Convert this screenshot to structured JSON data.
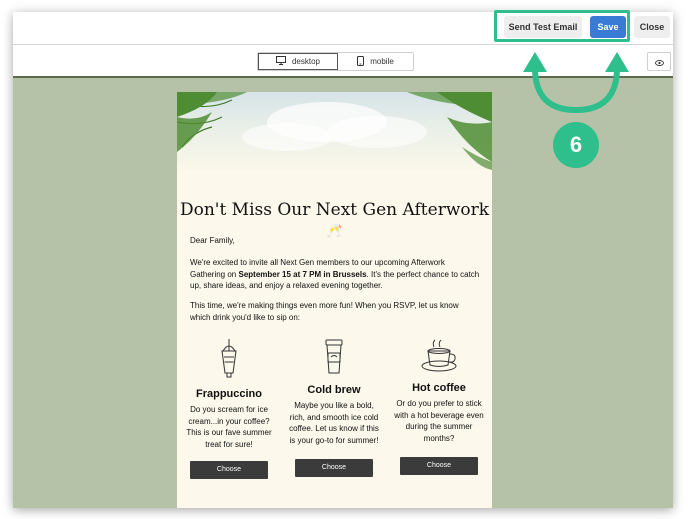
{
  "toolbar": {
    "send_test_label": "Send Test Email",
    "save_label": "Save",
    "close_label": "Close"
  },
  "view": {
    "desktop_label": "desktop",
    "mobile_label": "mobile",
    "active": "desktop"
  },
  "email": {
    "title": "Don't Miss Our Next Gen Afterwork",
    "title_emoji": "🥂",
    "greeting": "Dear Family,",
    "intro_pre": "We're excited to invite all Next Gen members to our upcoming Afterwork Gathering on ",
    "intro_bold": "September 15 at 7 PM in Brussels",
    "intro_post": ". It's the perfect chance to catch up, share ideas, and enjoy a relaxed evening together.",
    "rsvp_text": "This time, we're making things even more fun! When you RSVP, let us know which drink you'd like to sip on:",
    "drinks": [
      {
        "name": "Frappuccino",
        "desc": "Do you scream for ice cream...in your coffee? This is our fave summer treat for sure!",
        "icon": "frappuccino-icon",
        "button": "Choose"
      },
      {
        "name": "Cold brew",
        "desc": "Maybe you like a bold, rich, and smooth ice cold coffee. Let us know if this is your go-to for summer!",
        "icon": "cold-brew-icon",
        "button": "Choose"
      },
      {
        "name": "Hot coffee",
        "desc": "Or do you prefer to stick with a hot beverage even during the summer months?",
        "icon": "hot-coffee-icon",
        "button": "Choose"
      }
    ]
  },
  "annotation": {
    "step_number": "6",
    "color": "#2ebf8c"
  },
  "colors": {
    "canvas_bg": "#b6c2a8",
    "save_button": "#3a7bd5",
    "choose_button": "#3b3b3b",
    "email_bg": "#fcf8ec"
  }
}
